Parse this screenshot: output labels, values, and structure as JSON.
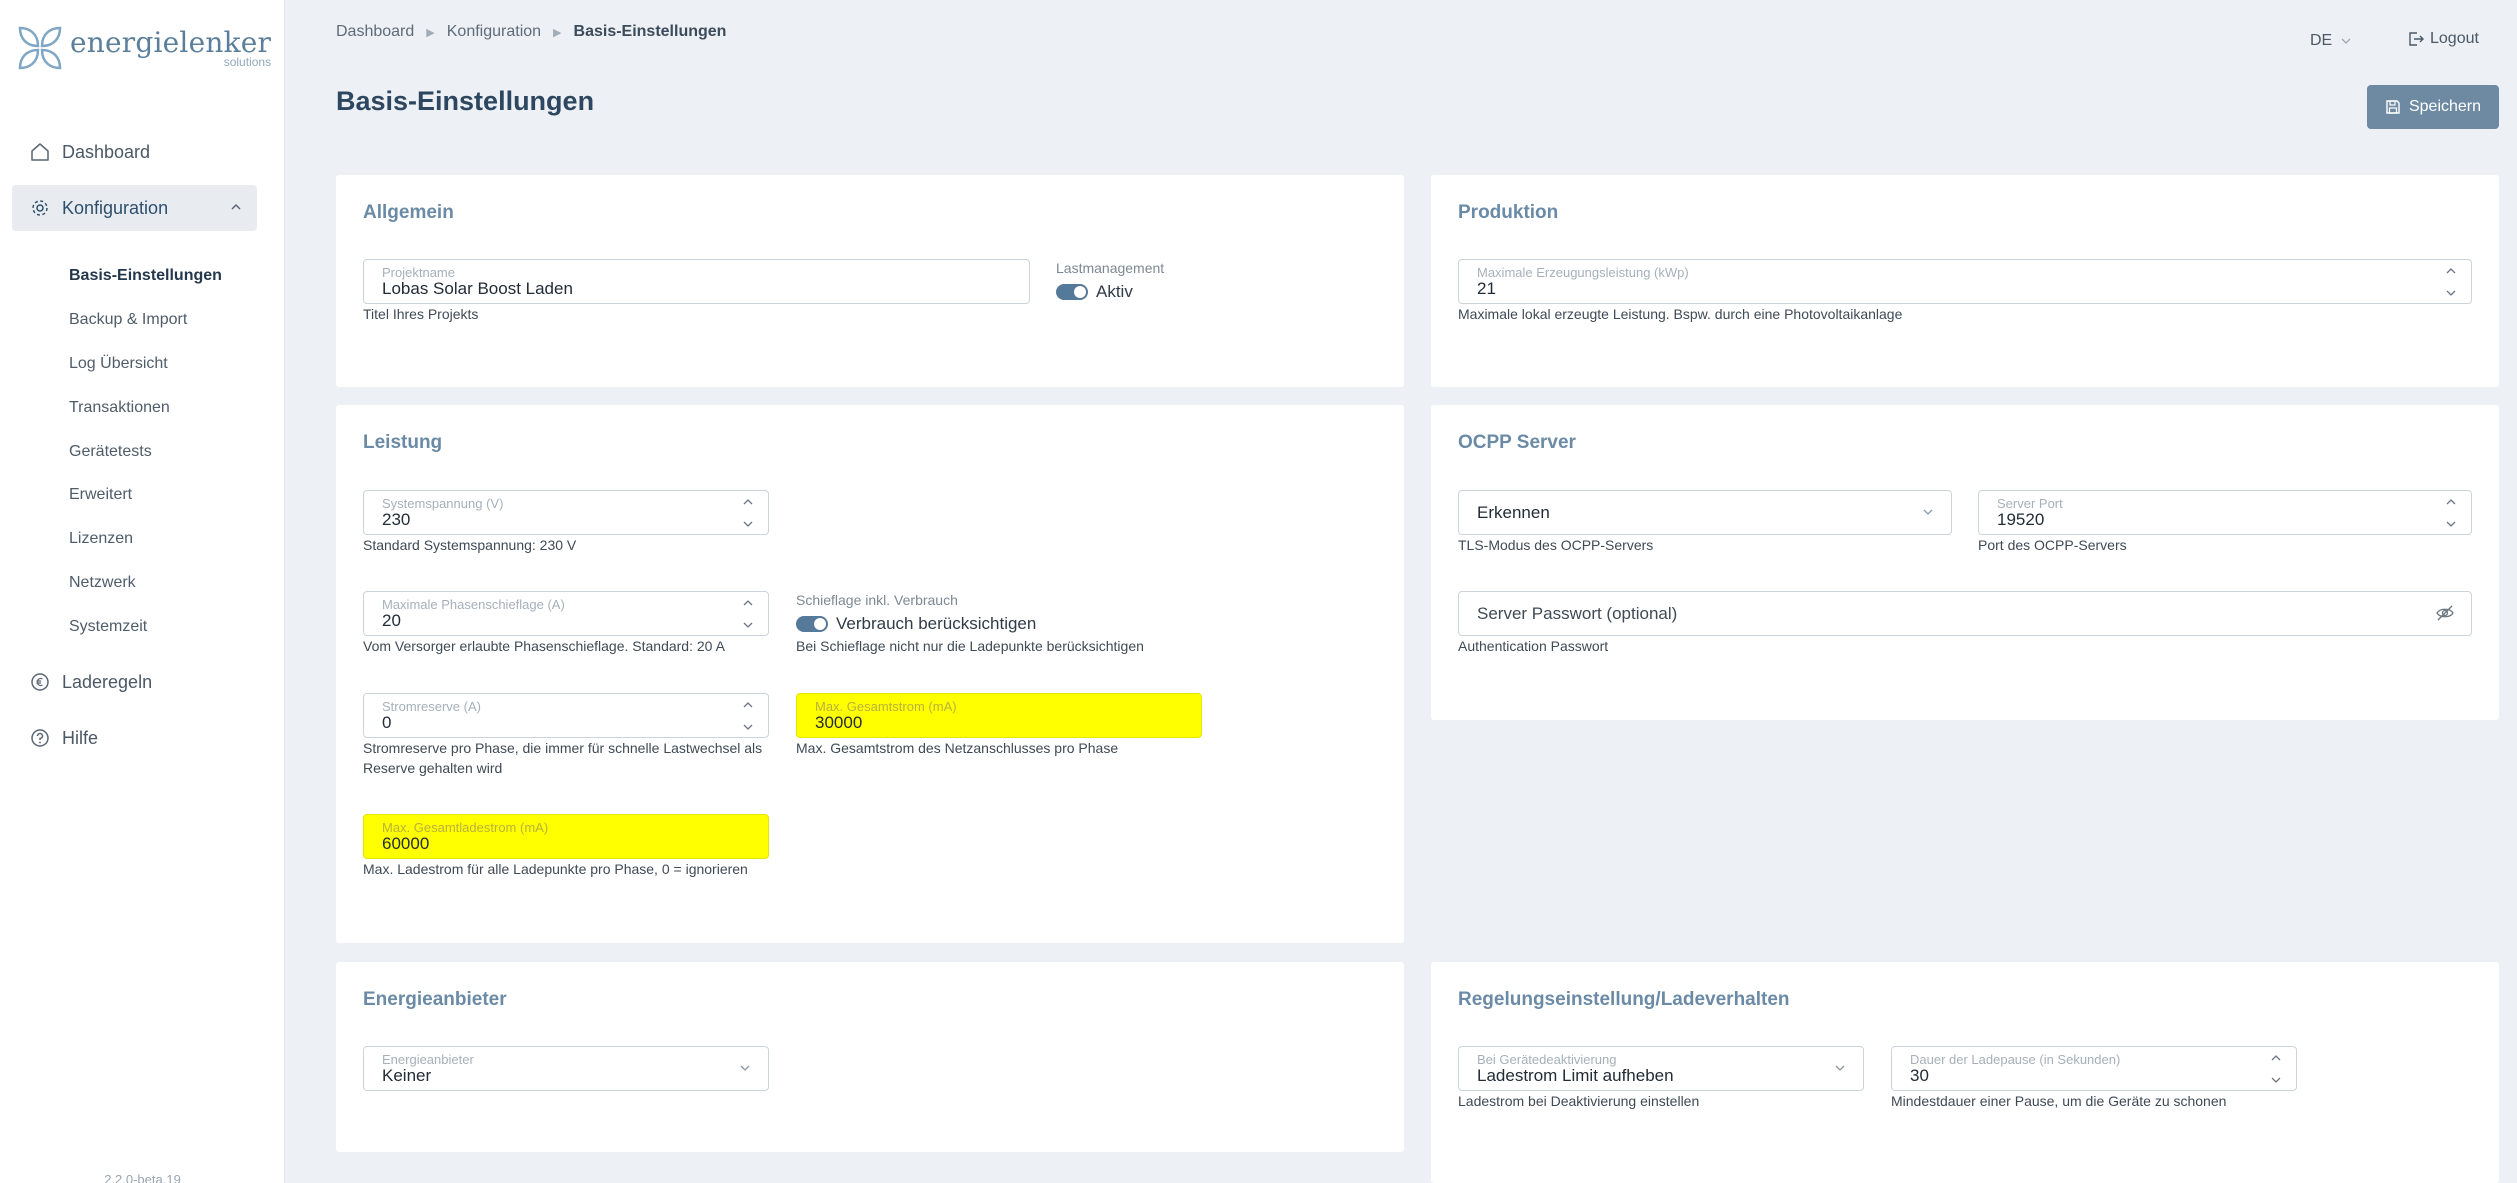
{
  "brand": {
    "name": "energielenker",
    "sub": "solutions"
  },
  "sidebar": {
    "items": [
      {
        "label": "Dashboard",
        "icon": "home-icon"
      },
      {
        "label": "Konfiguration",
        "icon": "gear-icon"
      },
      {
        "label": "Laderegeln",
        "icon": "euro-circle-icon"
      },
      {
        "label": "Hilfe",
        "icon": "help-circle-icon"
      }
    ],
    "subitems": [
      "Basis-Einstellungen",
      "Backup & Import",
      "Log Übersicht",
      "Transaktionen",
      "Gerätetests",
      "Erweitert",
      "Lizenzen",
      "Netzwerk",
      "Systemzeit"
    ],
    "version": "2.2.0-beta.19"
  },
  "breadcrumb": [
    "Dashboard",
    "Konfiguration",
    "Basis-Einstellungen"
  ],
  "header": {
    "lang": "DE",
    "logout": "Logout"
  },
  "page": {
    "title": "Basis-Einstellungen",
    "save_label": "Speichern"
  },
  "colors": {
    "accent": "#6e8aa3",
    "highlight": "#ffff00",
    "title": "#6a8aa6"
  },
  "allgemein": {
    "title": "Allgemein",
    "projektname": {
      "label": "Projektname",
      "value": "Lobas Solar Boost Laden",
      "hint": "Titel Ihres Projekts"
    },
    "lastmanagement": {
      "label": "Lastmanagement",
      "value": "Aktiv"
    }
  },
  "produktion": {
    "title": "Produktion",
    "max_erzeugung": {
      "label": "Maximale Erzeugungsleistung (kWp)",
      "value": "21",
      "hint": "Maximale lokal erzeugte Leistung. Bspw. durch eine Photovoltaikanlage"
    }
  },
  "leistung": {
    "title": "Leistung",
    "systemspannung": {
      "label": "Systemspannung (V)",
      "value": "230",
      "hint": "Standard Systemspannung: 230 V"
    },
    "phasenschieflage": {
      "label": "Maximale Phasenschieflage (A)",
      "value": "20",
      "hint": "Vom Versorger erlaubte Phasenschieflage. Standard: 20 A"
    },
    "schieflage_verbrauch": {
      "label": "Schieflage inkl. Verbrauch",
      "value": "Verbrauch berücksichtigen",
      "hint": "Bei Schieflage nicht nur die Ladepunkte berücksichtigen"
    },
    "stromreserve": {
      "label": "Stromreserve (A)",
      "value": "0",
      "hint_1": "Stromreserve pro Phase, die immer für schnelle Lastwechsel als",
      "hint_2": "Reserve gehalten wird"
    },
    "max_gesamtstrom": {
      "label": "Max. Gesamtstrom (mA)",
      "value": "30000",
      "hint": "Max. Gesamtstrom des Netzanschlusses pro Phase"
    },
    "max_gesamtladestrom": {
      "label": "Max. Gesamtladestrom (mA)",
      "value": "60000",
      "hint": "Max. Ladestrom für alle Ladepunkte pro Phase, 0 = ignorieren"
    }
  },
  "ocpp": {
    "title": "OCPP Server",
    "tls": {
      "value": "Erkennen",
      "hint": "TLS-Modus des OCPP-Servers"
    },
    "port": {
      "label": "Server Port",
      "value": "19520",
      "hint": "Port des OCPP-Servers"
    },
    "passwort": {
      "placeholder": "Server Passwort (optional)",
      "hint": "Authentication Passwort"
    }
  },
  "energieanbieter": {
    "title": "Energieanbieter",
    "anbieter": {
      "label": "Energieanbieter",
      "value": "Keiner"
    }
  },
  "regelung": {
    "title": "Regelungseinstellung/Ladeverhalten",
    "deaktivierung": {
      "label": "Bei Gerätedeaktivierung",
      "value": "Ladestrom Limit aufheben",
      "hint": "Ladestrom bei Deaktivierung einstellen"
    },
    "ladepause": {
      "label": "Dauer der Ladepause (in Sekunden)",
      "value": "30",
      "hint": "Mindestdauer einer Pause, um die Geräte zu schonen"
    }
  }
}
